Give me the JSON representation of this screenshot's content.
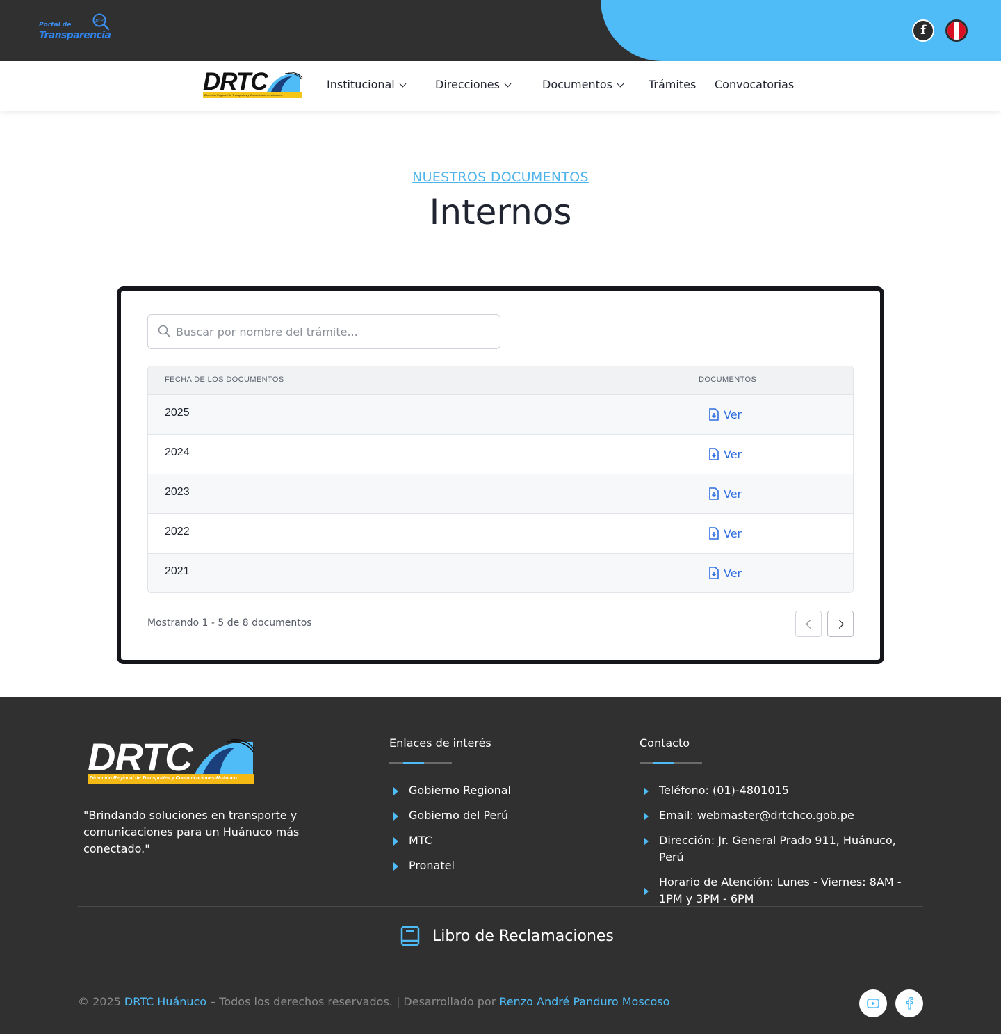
{
  "topbar": {
    "transparency_logo": {
      "line1": "Portal de",
      "line2": "Transparencia",
      "badge": "pte"
    }
  },
  "nav": {
    "logo": {
      "text": "DRTC",
      "tagline": "Dirección Regional de Transportes y Comunicaciones-Huánuco"
    },
    "items": [
      {
        "label": "Institucional",
        "dropdown": true
      },
      {
        "label": "Direcciones",
        "dropdown": true
      },
      {
        "label": "Documentos",
        "dropdown": true
      },
      {
        "label": "Trámites",
        "dropdown": false
      },
      {
        "label": "Convocatorias",
        "dropdown": false
      }
    ]
  },
  "heading": {
    "eyebrow": "NUESTROS DOCUMENTOS",
    "title": "Internos"
  },
  "search": {
    "placeholder": "Buscar por nombre del trámite...",
    "value": ""
  },
  "table": {
    "headers": {
      "date": "FECHA DE LOS DOCUMENTOS",
      "docs": "DOCUMENTOS"
    },
    "rows": [
      {
        "year": "2025",
        "action": "Ver"
      },
      {
        "year": "2024",
        "action": "Ver"
      },
      {
        "year": "2023",
        "action": "Ver"
      },
      {
        "year": "2022",
        "action": "Ver"
      },
      {
        "year": "2021",
        "action": "Ver"
      }
    ]
  },
  "pagination": {
    "summary": "Mostrando 1 - 5 de 8 documentos"
  },
  "footer": {
    "logo": {
      "text": "DRTC",
      "tagline": "Dirección Regional de Transportes y Comunicaciones-Huánuco"
    },
    "quote": "\"Brindando soluciones en transporte y comunicaciones para un Huánuco más conectado.\"",
    "links_title": "Enlaces de interés",
    "links": [
      "Gobierno Regional",
      "Gobierno del Perú",
      "MTC",
      "Pronatel"
    ],
    "contact_title": "Contacto",
    "contact": [
      "Teléfono: (01)-4801015",
      "Email: webmaster@drtchco.gob.pe",
      "Dirección: Jr. General Prado 911, Huánuco, Perú",
      "Horario de Atención: Lunes - Viernes: 8AM - 1PM y 3PM - 6PM"
    ],
    "libro": "Libro de Reclamaciones",
    "copyright": {
      "prefix": "© 2025",
      "org": "DRTC Huánuco",
      "middle": "– Todos los derechos reservados.  |  Desarrollado por",
      "dev": "Renzo André Panduro Moscoso"
    }
  },
  "colors": {
    "accent": "#4fbcf8",
    "link": "#2f6fe0",
    "dark": "#303030"
  }
}
